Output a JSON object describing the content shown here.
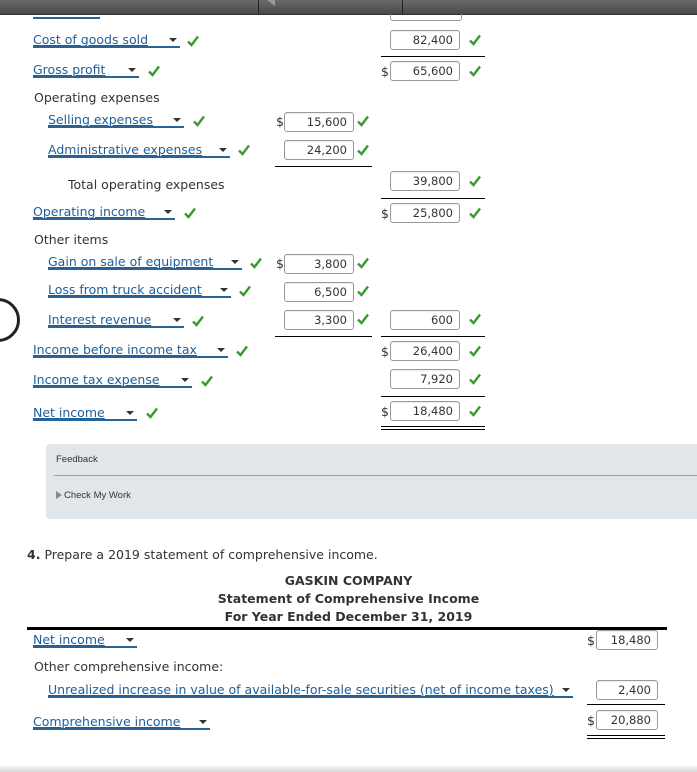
{
  "income_statement": {
    "rows": [
      {
        "label": "Cost of goods sold",
        "amount": "82,400",
        "correct": true
      },
      {
        "label": "Gross profit",
        "dollar": "$",
        "amount": "65,600",
        "correct": true
      },
      {
        "heading": "Operating expenses"
      },
      {
        "label": "Selling expenses",
        "dollar": "$",
        "amount": "15,600",
        "correct": true
      },
      {
        "label": "Administrative expenses",
        "amount": "24,200",
        "correct": true
      },
      {
        "heading": "Total operating expenses",
        "amount": "39,800",
        "correct": true
      },
      {
        "label": "Operating income",
        "dollar": "$",
        "amount": "25,800",
        "correct": true
      },
      {
        "heading": "Other items"
      },
      {
        "label": "Gain on sale of equipment",
        "dollar": "$",
        "amount": "3,800",
        "correct": true
      },
      {
        "label": "Loss from truck accident",
        "amount": "6,500",
        "correct": true
      },
      {
        "label": "Interest revenue",
        "amount": "3,300",
        "correct": true,
        "total": "600"
      },
      {
        "label": "Income before income tax",
        "dollar": "$",
        "amount": "26,400",
        "correct": true
      },
      {
        "label": "Income tax expense",
        "amount": "7,920",
        "correct": true
      },
      {
        "label": "Net income",
        "dollar": "$",
        "amount": "18,480",
        "correct": true
      }
    ]
  },
  "feedback": {
    "title": "Feedback",
    "check_my_work": "Check My Work"
  },
  "question4": {
    "number": "4.",
    "prompt": "Prepare a 2019 statement of comprehensive income.",
    "company": "GASKIN COMPANY",
    "statement_title": "Statement of Comprehensive Income",
    "period": "For Year Ended December 31, 2019",
    "rows": {
      "net_income": {
        "label": "Net income",
        "dollar": "$",
        "amount": "18,480"
      },
      "oci_heading": "Other comprehensive income:",
      "unrealized": {
        "label": "Unrealized increase in value of available-for-sale securities (net of income taxes)",
        "amount": "2,400"
      },
      "comprehensive": {
        "label": "Comprehensive income",
        "dollar": "$",
        "amount": "20,880"
      }
    }
  },
  "colors": {
    "check_green": "#3a9a2f",
    "link_blue": "#1f5f99",
    "feedback_bg": "#e1e6ea"
  }
}
